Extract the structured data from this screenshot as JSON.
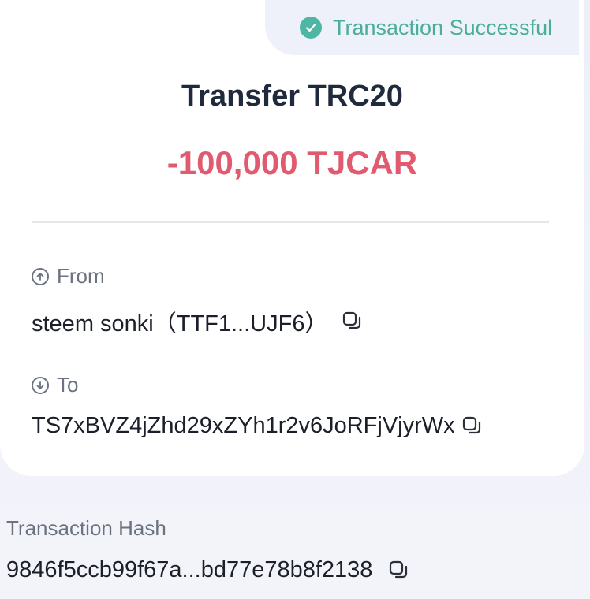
{
  "status": {
    "text": "Transaction Successful",
    "color": "#4aae9b",
    "icon": "check-circle-icon"
  },
  "title": "Transfer TRC20",
  "amount": {
    "text": "-100,000 TJCAR",
    "color": "#e05b6f"
  },
  "from": {
    "label": "From",
    "icon": "arrow-up-circle-icon",
    "value": "steem sonki（TTF1...UJF6）"
  },
  "to": {
    "label": "To",
    "icon": "arrow-down-circle-icon",
    "value": "TS7xBVZ4jZhd29xZYh1r2v6JoRFjVjyrWx"
  },
  "hash": {
    "label": "Transaction Hash",
    "value": "9846f5ccb99f67a...bd77e78b8f2138"
  }
}
